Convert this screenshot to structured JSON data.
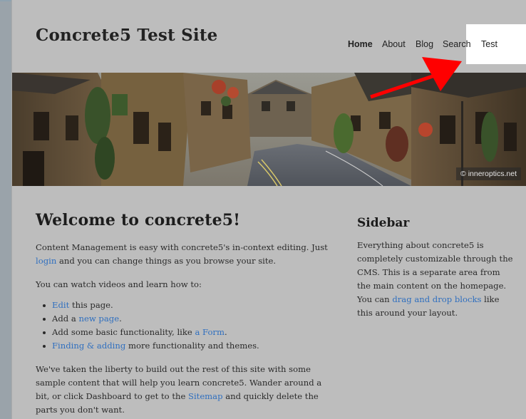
{
  "site": {
    "title": "Concrete5 Test Site"
  },
  "nav": {
    "items": [
      {
        "label": "Home",
        "active": true
      },
      {
        "label": "About"
      },
      {
        "label": "Blog"
      },
      {
        "label": "Search"
      },
      {
        "label": "Test"
      }
    ]
  },
  "hero": {
    "credit": "© inneroptics.net"
  },
  "annotation": {
    "arrow_color": "#ff0000"
  },
  "main": {
    "heading": "Welcome to concrete5!",
    "p1": {
      "before": "Content Management is easy with concrete5's in-context editing. Just ",
      "link": "login",
      "after": " and you can change things as you browse your site."
    },
    "p2": "You can watch videos and learn how to:",
    "list": [
      {
        "link": "Edit",
        "after": " this page."
      },
      {
        "before": "Add a ",
        "link": "new page",
        "after": "."
      },
      {
        "before": "Add some basic functionality, like ",
        "link": "a Form",
        "after": "."
      },
      {
        "link": "Finding & adding",
        "after": " more functionality and themes."
      }
    ],
    "p3": {
      "before": "We've taken the liberty to build out the rest of this site with some sample content that will help you learn concrete5. Wander around a bit, or click Dashboard to get to the ",
      "link": "Sitemap",
      "after": " and quickly delete the parts you don't want."
    }
  },
  "sidebar": {
    "heading": "Sidebar",
    "before": "Everything about concrete5 is completely customizable through the CMS. This is a separate area from the main content on the homepage. You can ",
    "link": "drag and drop blocks",
    "after": " like this around your layout."
  },
  "colors": {
    "link": "#2f6fbf",
    "page_bg": "#bdbdbd",
    "arrow": "#ff0000"
  }
}
